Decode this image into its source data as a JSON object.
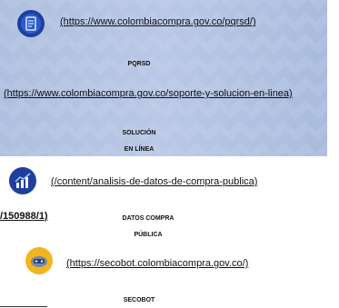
{
  "links": {
    "pqrsd": "(https://www.colombiacompra.gov.co/pqrsd/)",
    "soporte": " (https://www.colombiacompra.gov.co/soporte-y-solucion-en-linea)",
    "analisis": " (/content/analisis-de-datos-de-compra-publica)",
    "partial": "/150988/1)",
    "secobot": " (https://secobot.colombiacompra.gov.co/)"
  },
  "captions": {
    "pqrsd": "PQRSD",
    "solucion_1": "SOLUCIÓN",
    "solucion_2": "EN LÍNEA",
    "datos_1": "DATOS COMPRA",
    "datos_2": "PÚBLICA",
    "secobot": "SECOBOT"
  },
  "icons": [
    "document-icon",
    "chart-icon",
    "secobot-icon"
  ],
  "colors": {
    "panel": "#b4c4e3",
    "icon_blue": "#1f3f9f",
    "icon_yellow": "#f2b51c"
  }
}
